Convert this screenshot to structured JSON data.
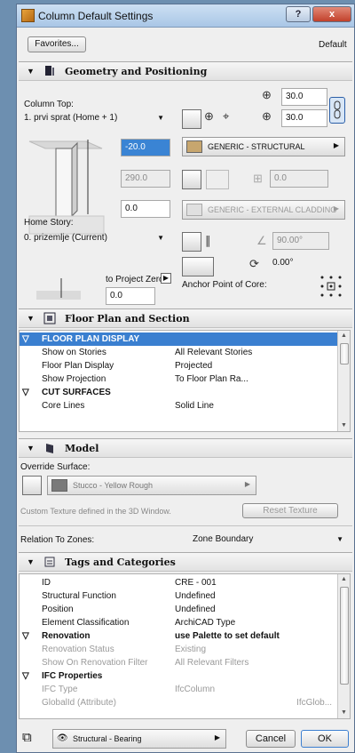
{
  "window": {
    "title": "Column Default Settings",
    "help": "?",
    "close": "x"
  },
  "top": {
    "favorites": "Favorites...",
    "default": "Default"
  },
  "geometry": {
    "title": "Geometry and Positioning",
    "column_top_label": "Column Top:",
    "column_top_value": "1. prvi sprat (Home + 1)",
    "offset_top": "-20.0",
    "height": "290.0",
    "bottom_offset": "0.0",
    "home_story_label": "Home Story:",
    "home_story_value": "0. prizemlje (Current)",
    "to_project_zero": "to Project Zero",
    "project_zero_value": "0.0",
    "width": "30.0",
    "depth": "30.0",
    "core_material": "GENERIC - STRUCTURAL",
    "veneer_thickness": "0.0",
    "veneer_material": "GENERIC - EXTERNAL CLADDING",
    "slant_angle": "90.00°",
    "rotation_angle": "0.00°",
    "anchor_label": "Anchor Point of Core:"
  },
  "floor_plan": {
    "title": "Floor Plan and Section",
    "rows": [
      {
        "type": "head",
        "label": "FLOOR PLAN DISPLAY",
        "value": ""
      },
      {
        "type": "row",
        "label": "Show on Stories",
        "value": "All Relevant Stories"
      },
      {
        "type": "row",
        "label": "Floor Plan Display",
        "value": "Projected"
      },
      {
        "type": "row",
        "label": "Show Projection",
        "value": "To Floor Plan Ra..."
      },
      {
        "type": "sub",
        "label": "CUT SURFACES",
        "value": ""
      },
      {
        "type": "row",
        "label": "Core Lines",
        "value": "Solid Line"
      }
    ]
  },
  "model": {
    "title": "Model",
    "override_label": "Override Surface:",
    "surface": "Stucco - Yellow Rough",
    "custom_texture": "Custom Texture defined in the 3D Window.",
    "reset_texture": "Reset Texture",
    "zones_label": "Relation To Zones:",
    "zones_value": "Zone Boundary"
  },
  "tags": {
    "title": "Tags and Categories",
    "rows": [
      {
        "type": "row",
        "label": "ID",
        "value": "CRE - 001"
      },
      {
        "type": "row",
        "label": "Structural Function",
        "value": "Undefined"
      },
      {
        "type": "row",
        "label": "Position",
        "value": "Undefined"
      },
      {
        "type": "row",
        "label": "Element Classification",
        "value": "ArchiCAD Type"
      },
      {
        "type": "sub",
        "label": "Renovation",
        "value": "use Palette to set default"
      },
      {
        "type": "grey",
        "label": "Renovation Status",
        "value": "Existing"
      },
      {
        "type": "grey",
        "label": "Show On Renovation Filter",
        "value": "All Relevant Filters"
      },
      {
        "type": "sub",
        "label": "IFC Properties",
        "value": ""
      },
      {
        "type": "grey",
        "label": "IFC Type",
        "value": "IfcColumn"
      },
      {
        "type": "grey",
        "label": "GlobalId (Attribute)",
        "value": "",
        "extra": "IfcGlob..."
      }
    ]
  },
  "footer": {
    "layer": "Structural - Bearing",
    "cancel": "Cancel",
    "ok": "OK"
  }
}
